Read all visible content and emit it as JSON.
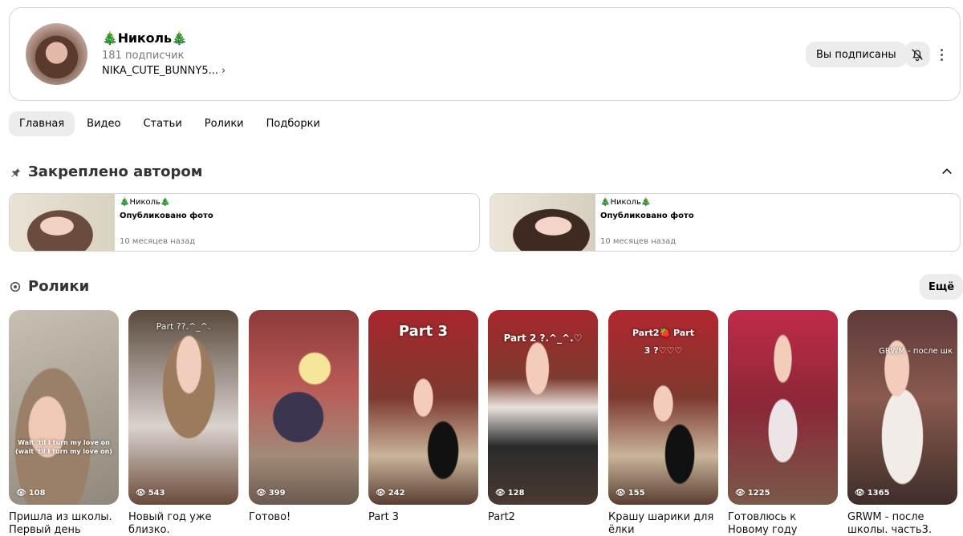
{
  "channel": {
    "name": "🎄Николь🎄",
    "subscribers": "181 подписчик",
    "handle": "NIKA_CUTE_BUNNY5...",
    "subscribed_label": "Вы подписаны"
  },
  "tabs": [
    {
      "label": "Главная",
      "active": true
    },
    {
      "label": "Видео",
      "active": false
    },
    {
      "label": "Статьи",
      "active": false
    },
    {
      "label": "Ролики",
      "active": false
    },
    {
      "label": "Подборки",
      "active": false
    }
  ],
  "pinned": {
    "heading": "Закреплено автором",
    "items": [
      {
        "title": "🎄Николь🎄",
        "description": "Опубликовано фото",
        "date": "10 месяцев назад"
      },
      {
        "title": "🎄Николь🎄",
        "description": "Опубликовано фото",
        "date": "10 месяцев назад"
      }
    ]
  },
  "reels": {
    "heading": "Ролики",
    "more_label": "Ещё",
    "items": [
      {
        "title": "Пришла из школы. Первый день после...",
        "views": "108",
        "overlay": "Wait 'til I turn my love on (wait 'til I turn my love on)"
      },
      {
        "title": "Новый год уже близко. Последние...",
        "views": "543",
        "overlay": "Part ??.^_^."
      },
      {
        "title": "Готово!",
        "views": "399",
        "overlay": ""
      },
      {
        "title": "Part 3",
        "views": "242",
        "overlay": "Part 3"
      },
      {
        "title": "Part2",
        "views": "128",
        "overlay": "Part 2 ?.^_^.♡"
      },
      {
        "title": "Крашу шарики для ёлки",
        "views": "155",
        "overlay": "Part2🍓 Part 3 ?♡♡♡"
      },
      {
        "title": "Готовлюсь к Новому году",
        "views": "1225",
        "overlay": ""
      },
      {
        "title": "GRWM - после школы. часть3.",
        "views": "1365",
        "overlay": "GRWM - после шк"
      }
    ]
  },
  "colors": {
    "chip_bg": "#ececec",
    "border": "#d6d6d6",
    "muted_text": "#777777"
  }
}
